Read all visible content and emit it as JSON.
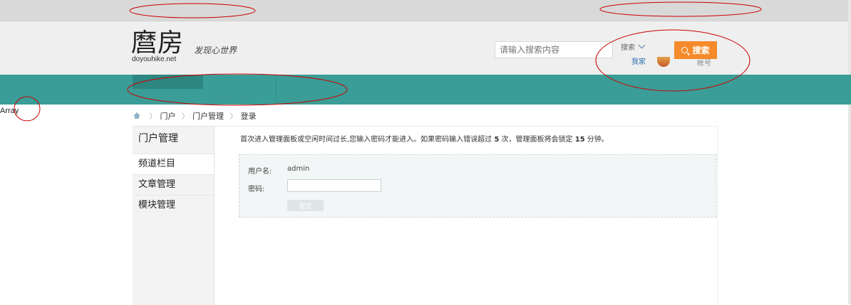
{
  "logo": {
    "title": "麿房",
    "domain": "doyouhike.net",
    "slogan": "发现心世界"
  },
  "search": {
    "placeholder": "请输入搜索内容",
    "type_label": "搜索",
    "button_label": "搜索"
  },
  "user": {
    "link_text": "我家",
    "name": "帐号"
  },
  "debug": {
    "array_text": "Array"
  },
  "breadcrumb": {
    "items": [
      "门户",
      "门户管理",
      "登录"
    ],
    "separator": "〉"
  },
  "sidebar": {
    "title": "门户管理",
    "items": [
      {
        "label": "频道栏目",
        "active": true
      },
      {
        "label": "文章管理",
        "active": false
      },
      {
        "label": "模块管理",
        "active": false
      }
    ]
  },
  "notice": {
    "part1": "首次进入管理面板或空闲时间过长,您输入密码才能进入。如果密码输入错误超过 ",
    "count": "5",
    "part2": " 次，管理面板将会锁定 ",
    "minutes": "15",
    "part3": " 分钟。"
  },
  "login": {
    "username_label": "用户名:",
    "username_value": "admin",
    "password_label": "密码:",
    "submit_label": "提交"
  },
  "colors": {
    "nav": "#3a9d97",
    "search_button": "#f58b2a",
    "annotation": "#cc0000"
  }
}
